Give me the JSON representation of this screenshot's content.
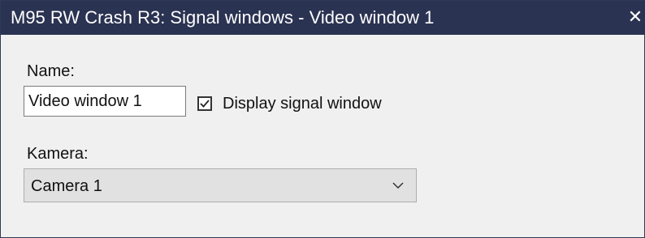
{
  "window": {
    "title": "M95 RW Crash R3: Signal windows - Video window 1",
    "close_glyph": "✕"
  },
  "form": {
    "name_label": "Name:",
    "name_value": "Video window 1",
    "display_checkbox_label": "Display signal window",
    "display_checked": true,
    "camera_label": "Kamera:",
    "camera_value": "Camera 1"
  },
  "icons": {
    "close": "close-icon",
    "check": "check-icon",
    "dropdown": "chevron-down-icon"
  },
  "colors": {
    "titlebar": "#2b3352",
    "background": "#f0f0f0",
    "select_background": "#e1e1e1"
  }
}
